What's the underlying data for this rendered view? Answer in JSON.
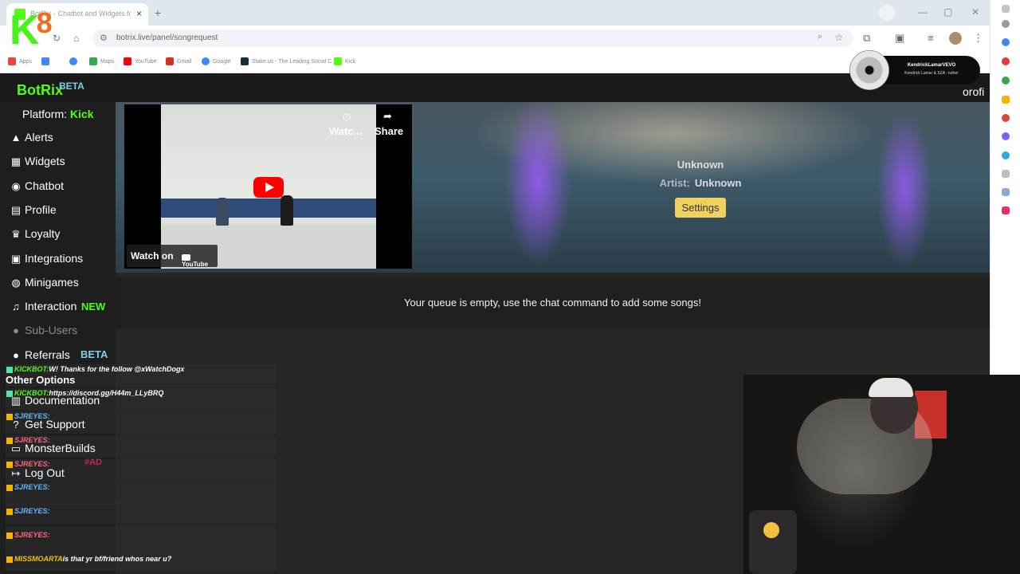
{
  "browser": {
    "tab_title": "BotRix - Chatbot and Widgets for Kick, Twitch",
    "new_tab": "+",
    "tab_close": "×",
    "url": "botrix.live/panel/songrequest",
    "bookmarks": [
      {
        "label": "Apps",
        "color": "#e8453c"
      },
      {
        "label": "",
        "color": "#4285f4"
      },
      {
        "label": "",
        "color": "#4285f4"
      },
      {
        "label": "Maps",
        "color": "#34a853"
      },
      {
        "label": "YouTube",
        "color": "#ff0000"
      },
      {
        "label": "Gmail",
        "color": "#d93025"
      },
      {
        "label": "Google",
        "color": "#4285f4"
      },
      {
        "label": "Stake.us - The Leading Social C...",
        "color": "#1a2c38"
      },
      {
        "label": "Kick",
        "color": "#53fc18"
      }
    ]
  },
  "overlay_logo": {
    "k": "K",
    "eight": "8"
  },
  "now_playing": {
    "artist": "KendrickLamarVEVO",
    "song": "Kendrick Lamar & SZA - luther"
  },
  "site": {
    "brand": "BotRix",
    "brand_beta": "BETA",
    "profile_partial": "orofi",
    "platform_label": "Platform:",
    "platform_value": "Kick",
    "nav": [
      {
        "icon": "alert-icon",
        "glyph": "▲",
        "label": "Alerts"
      },
      {
        "icon": "widgets-icon",
        "glyph": "▦",
        "label": "Widgets"
      },
      {
        "icon": "chatbot-icon",
        "glyph": "◉",
        "label": "Chatbot"
      },
      {
        "icon": "profile-icon",
        "glyph": "▤",
        "label": "Profile"
      },
      {
        "icon": "trophy-icon",
        "glyph": "♛",
        "label": "Loyalty"
      },
      {
        "icon": "integrations-icon",
        "glyph": "▣",
        "label": "Integrations"
      },
      {
        "icon": "gamepad-icon",
        "glyph": "◍",
        "label": "Minigames"
      },
      {
        "icon": "music-icon",
        "glyph": "♫",
        "label": "Interaction"
      },
      {
        "icon": "users-icon",
        "glyph": "●",
        "label": "Sub-Users"
      },
      {
        "icon": "referrals-icon",
        "glyph": "●",
        "label": "Referrals"
      }
    ],
    "interaction_tag": "NEW",
    "referrals_tag": "BETA",
    "other_options": "Other Options",
    "other_nav": [
      {
        "icon": "book-icon",
        "glyph": "▥",
        "label": "Documentation"
      },
      {
        "icon": "help-icon",
        "glyph": "?",
        "label": "Get Support"
      },
      {
        "icon": "monitor-icon",
        "glyph": "▭",
        "label": "MonsterBuilds"
      },
      {
        "icon": "logout-icon",
        "glyph": "↦",
        "label": "Log Out"
      }
    ]
  },
  "player": {
    "watch_label": "Watc...",
    "share_label": "Share",
    "watch_on": "Watch on",
    "youtube": "YouTube"
  },
  "song": {
    "title": "Unknown",
    "artist_label": "Artist:",
    "artist_value": "Unknown",
    "settings_button": "Settings"
  },
  "queue": {
    "empty_message": "Your queue is empty, use the chat command to add some songs!"
  },
  "chat": [
    {
      "user": "KICKBOT:",
      "text": "W! Thanks for the follow @xWatchDogx"
    },
    {
      "user": "KICKBOT:",
      "text": "https://discord.gg/H44m_LLyBRQ"
    },
    {
      "user": "SJREYES:",
      "text": ""
    },
    {
      "user": "SJREYES:",
      "text": ""
    },
    {
      "user": "SJREYES:",
      "text": ""
    },
    {
      "user": "SJREYES:",
      "text": ""
    },
    {
      "user": "SJREYES:",
      "text": ""
    },
    {
      "user": "SJREYES:",
      "text": ""
    },
    {
      "user": "MISSMOARTA",
      "text": "is that yr bf/friend whos near u?"
    }
  ],
  "chat_ad": "#AD",
  "colors": {
    "kick_green": "#53fc18",
    "beta_blue": "#7ecfe8",
    "settings_yellow": "#f0d15e"
  }
}
